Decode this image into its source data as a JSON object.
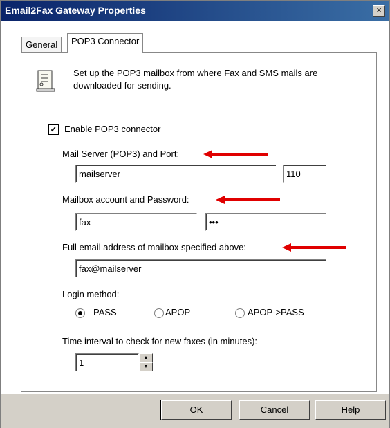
{
  "window": {
    "title": "Email2Fax Gateway Properties",
    "close_glyph": "×"
  },
  "tabs": [
    {
      "label": "General",
      "active": false
    },
    {
      "label": "POP3 Connector",
      "active": true
    }
  ],
  "intro_text": "Set up the POP3 mailbox from where Fax and SMS mails are downloaded for sending.",
  "enable_pop3": {
    "label": "Enable POP3 connector",
    "checked": true,
    "check_glyph": "✓"
  },
  "mail_server": {
    "label": "Mail Server (POP3) and Port:",
    "server": "mailserver",
    "port": "110"
  },
  "mailbox": {
    "label": "Mailbox account and Password:",
    "account": "fax",
    "password": "•••"
  },
  "email": {
    "label": "Full email address of mailbox specified above:",
    "value": "fax@mailserver"
  },
  "login": {
    "label": "Login method:",
    "options": [
      "PASS",
      "APOP",
      "APOP->PASS"
    ],
    "selected": "PASS"
  },
  "interval": {
    "label": "Time interval to check for new faxes (in minutes):",
    "value": "1"
  },
  "buttons": {
    "ok": "OK",
    "cancel": "Cancel",
    "help": "Help"
  },
  "colors": {
    "arrow": "#e00000",
    "titlebar_start": "#0a246a",
    "titlebar_end": "#3a6ea5"
  }
}
